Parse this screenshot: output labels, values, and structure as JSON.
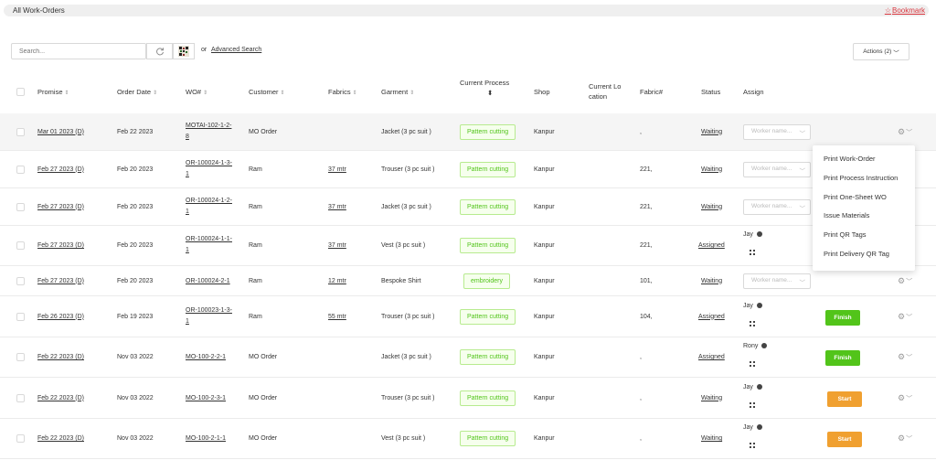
{
  "topbar": {
    "title": "All Work-Orders",
    "bookmark": "Bookmark"
  },
  "toolbar": {
    "search_placeholder": "Search...",
    "or": "or",
    "advanced_search": "Advanced Search",
    "actions": "Actions (2)"
  },
  "columns": {
    "promise": "Promise",
    "order_date": "Order Date",
    "wo": "WO#",
    "customer": "Customer",
    "fabrics": "Fabrics",
    "garment": "Garment",
    "current_process_1": "Current Process",
    "shop": "Shop",
    "current_location_1": "Current Lo",
    "current_location_2": "cation",
    "fabric_no": "Fabric#",
    "status": "Status",
    "assign": "Assign"
  },
  "worker_placeholder": "Worker name...",
  "rows": [
    {
      "promise": "Mar 01 2023 (D)",
      "order_date": "Feb 22 2023",
      "wo_1": "MOTAI-102-1-2-",
      "wo_2": "8",
      "customer": "MO Order",
      "fabrics": "",
      "garment": "Jacket (3 pc suit )",
      "process": "Pattern cutting",
      "shop": "Kanpur",
      "fabric_no": ",",
      "status": "Waiting"
    },
    {
      "promise": "Feb 27 2023 (D)",
      "order_date": "Feb 20 2023",
      "wo_1": "OR-100024-1-3-",
      "wo_2": "1",
      "customer": "Ram",
      "fabrics": "37 mtr",
      "garment": "Trouser (3 pc suit )",
      "process": "Pattern cutting",
      "shop": "Kanpur",
      "fabric_no": "221,",
      "status": "Waiting"
    },
    {
      "promise": "Feb 27 2023 (D)",
      "order_date": "Feb 20 2023",
      "wo_1": "OR-100024-1-2-",
      "wo_2": "1",
      "customer": "Ram",
      "fabrics": "37 mtr",
      "garment": "Jacket (3 pc suit )",
      "process": "Pattern cutting",
      "shop": "Kanpur",
      "fabric_no": "221,",
      "status": "Waiting"
    },
    {
      "promise": "Feb 27 2023 (D)",
      "order_date": "Feb 20 2023",
      "wo_1": "OR-100024-1-1-",
      "wo_2": "1",
      "customer": "Ram",
      "fabrics": "37 mtr",
      "garment": "Vest (3 pc suit )",
      "process": "Pattern cutting",
      "shop": "Kanpur",
      "fabric_no": "221,",
      "status": "Assigned",
      "assignee": "Jay"
    },
    {
      "promise": "Feb 27 2023 (D)",
      "order_date": "Feb 20 2023",
      "wo_1": "OR-100024-2-1",
      "wo_2": "",
      "customer": "Ram",
      "fabrics": "12 mtr",
      "garment": "Bespoke Shirt",
      "process": "embroidery",
      "shop": "Kanpur",
      "fabric_no": "101,",
      "status": "Waiting"
    },
    {
      "promise": "Feb 26 2023 (D)",
      "order_date": "Feb 19 2023",
      "wo_1": "OR-100023-1-3-",
      "wo_2": "1",
      "customer": "Ram",
      "fabrics": "55 mtr",
      "garment": "Trouser (3 pc suit )",
      "process": "Pattern cutting",
      "shop": "Kanpur",
      "fabric_no": "104,",
      "status": "Assigned",
      "assignee": "Jay",
      "action": "Finish"
    },
    {
      "promise": "Feb 22 2023 (D)",
      "order_date": "Nov 03 2022",
      "wo_1": "MO-100-2-2-1",
      "wo_2": "",
      "customer": "MO Order",
      "fabrics": "",
      "garment": "Jacket (3 pc suit )",
      "process": "Pattern cutting",
      "shop": "Kanpur",
      "fabric_no": ",",
      "status": "Assigned",
      "assignee": "Rony",
      "action": "Finish"
    },
    {
      "promise": "Feb 22 2023 (D)",
      "order_date": "Nov 03 2022",
      "wo_1": "MO-100-2-3-1",
      "wo_2": "",
      "customer": "MO Order",
      "fabrics": "",
      "garment": "Trouser (3 pc suit )",
      "process": "Pattern cutting",
      "shop": "Kanpur",
      "fabric_no": ",",
      "status": "Waiting",
      "assignee": "Jay",
      "action": "Start"
    },
    {
      "promise": "Feb 22 2023 (D)",
      "order_date": "Nov 03 2022",
      "wo_1": "MO-100-2-1-1",
      "wo_2": "",
      "customer": "MO Order",
      "fabrics": "",
      "garment": "Vest (3 pc suit )",
      "process": "Pattern cutting",
      "shop": "Kanpur",
      "fabric_no": ",",
      "status": "Waiting",
      "assignee": "Jay",
      "action": "Start"
    }
  ],
  "menu": [
    "Print Work-Order",
    "Print Process Instruction",
    "Print One-Sheet WO",
    "Issue Materials",
    "Print QR Tags",
    "Print Delivery QR Tag"
  ],
  "colors": {
    "accent_red": "#d9363e",
    "pill_green": "#52c41a",
    "finish_green": "#52c41a",
    "start_orange": "#f0a030"
  }
}
